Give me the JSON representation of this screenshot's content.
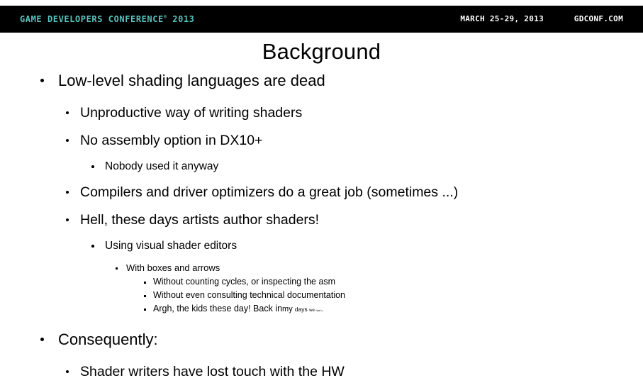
{
  "header": {
    "logo_text": "GAME DEVELOPERS CONFERENCE",
    "logo_reg": "®",
    "logo_year": " 2013",
    "dates": "MARCH 25-29, 2013",
    "url": "GDCONF.COM",
    "background_color": "#000000",
    "logo_color": "#57c3bd",
    "text_color": "#ffffff"
  },
  "slide": {
    "title": "Background",
    "bullets": [
      {
        "level": 1,
        "text": "Low-level shading languages are dead"
      },
      {
        "level": 2,
        "text": "Unproductive way of writing shaders"
      },
      {
        "level": 2,
        "text": "No assembly option in DX10+"
      },
      {
        "level": 3,
        "text": "Nobody used it anyway"
      },
      {
        "level": 2,
        "text": "Compilers and driver optimizers do a great job (sometimes ...)"
      },
      {
        "level": 2,
        "text": "Hell, these days artists author shaders!"
      },
      {
        "level": 3,
        "text": "Using visual shader editors"
      },
      {
        "level": 4,
        "text": "With boxes and arrows"
      },
      {
        "level": 5,
        "text": "Without counting cycles, or inspecting the asm"
      },
      {
        "level": 5,
        "text": "Without even consulting technical documentation"
      },
      {
        "level": 5,
        "text": "Argh, the kids these day! Back in "
      },
      {
        "level": 1,
        "text": "Consequently:"
      },
      {
        "level": 2,
        "text": "Shader writers have lost touch with the HW"
      }
    ],
    "shrinking_tail": {
      "part1": "my ",
      "part2": "days ",
      "part3": "we ",
      "part4": "had ",
      "part5": "to"
    }
  }
}
